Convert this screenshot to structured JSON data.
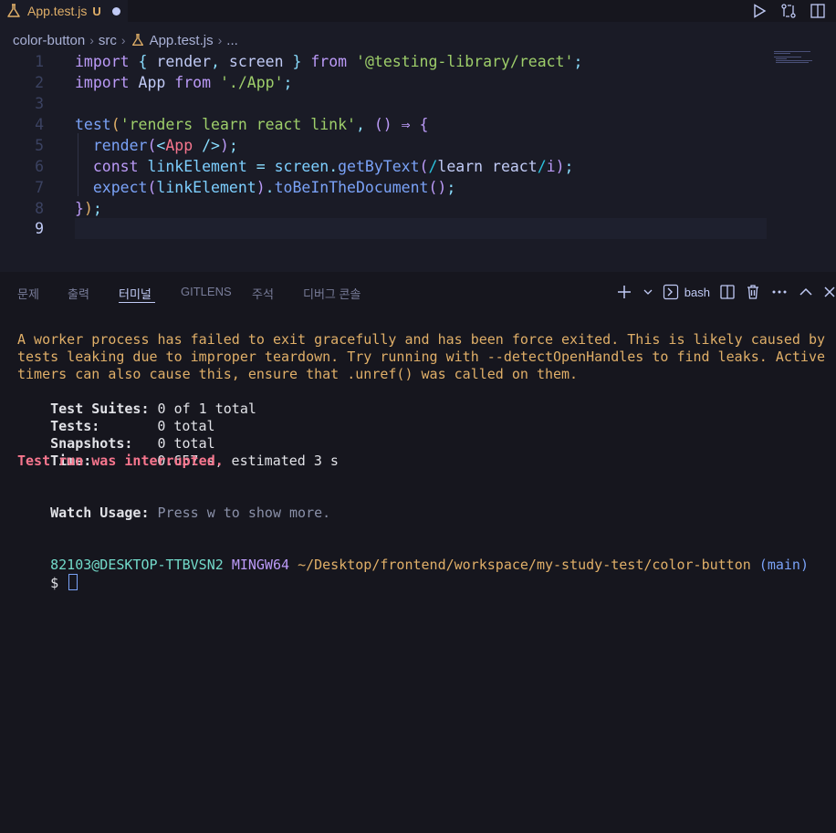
{
  "tab": {
    "filename": "App.test.js",
    "status": "U"
  },
  "breadcrumb": {
    "folder": "color-button",
    "subfolder": "src",
    "file": "App.test.js",
    "more": "..."
  },
  "editor": {
    "line_numbers": [
      "1",
      "2",
      "3",
      "4",
      "5",
      "6",
      "7",
      "8",
      "9"
    ],
    "active_line": "9"
  },
  "panel": {
    "tabs": [
      "문제",
      "출력",
      "터미널",
      "GITLENS",
      "주석",
      "디버그 콘솔"
    ],
    "active_tab": "터미널",
    "shell": "bash"
  },
  "terminal": {
    "warning_lines": [
      "A worker process has failed to exit gracefully and has been force exited. This is likely caused by",
      "tests leaking due to improper teardown. Try running with --detectOpenHandles to find leaks. Active",
      "timers can also cause this, ensure that .unref() was called on them."
    ],
    "suites_label": "Test Suites:",
    "suites_value": "0 of 1 total",
    "tests_label": "Tests:",
    "tests_value": "0 total",
    "snapshots_label": "Snapshots:",
    "snapshots_value": "0 total",
    "time_label": "Time:",
    "time_value": "0.657 s, estimated 3 s",
    "interrupted": "Test run was interrupted.",
    "watch_label": "Watch Usage:",
    "watch_value": "Press w to show more.",
    "prompt_user": "82103@DESKTOP-TTBVSN2",
    "prompt_env": "MINGW64",
    "prompt_path": "~/Desktop/frontend/workspace/my-study-test/color-button",
    "prompt_branch": "(main)",
    "prompt_symbol": "$"
  },
  "colors": {
    "accent": "#7aa2f7",
    "warning": "#e0af68",
    "error": "#f7768e",
    "background": "#1a1b26"
  }
}
